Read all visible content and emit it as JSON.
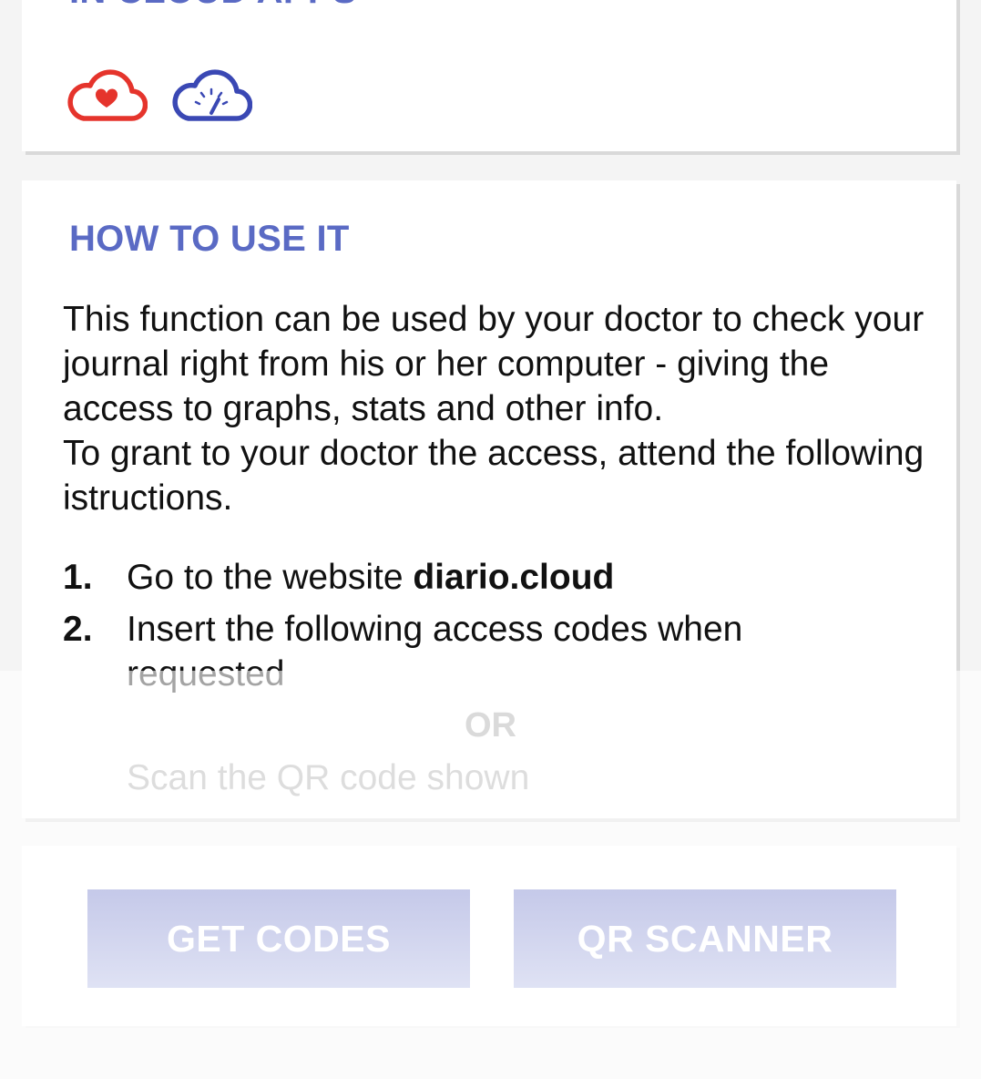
{
  "cloud_apps": {
    "title": "IN CLOUD APPS",
    "icons": [
      {
        "name": "heart-cloud-icon",
        "color": "#e5342c"
      },
      {
        "name": "gauge-cloud-icon",
        "color": "#3a48b4"
      }
    ]
  },
  "how_to": {
    "title": "HOW TO USE IT",
    "paragraph1": "This function can be used by your doctor to check your journal right from his or her computer - giving the access to graphs, stats and other info.",
    "paragraph2": "To grant to your doctor the access, attend the following istructions.",
    "steps": [
      {
        "number": "1.",
        "text": "Go to the website ",
        "emphasis": "diario.cloud"
      },
      {
        "number": "2.",
        "text": "Insert the following access codes when requested"
      }
    ],
    "or_label": "OR",
    "alternative": "Scan the QR code shown"
  },
  "actions": {
    "get_codes": "GET CODES",
    "qr_scanner": "QR SCANNER"
  },
  "colors": {
    "title_accent": "#5a6ac4",
    "button_bg": "#c5c9e9"
  }
}
